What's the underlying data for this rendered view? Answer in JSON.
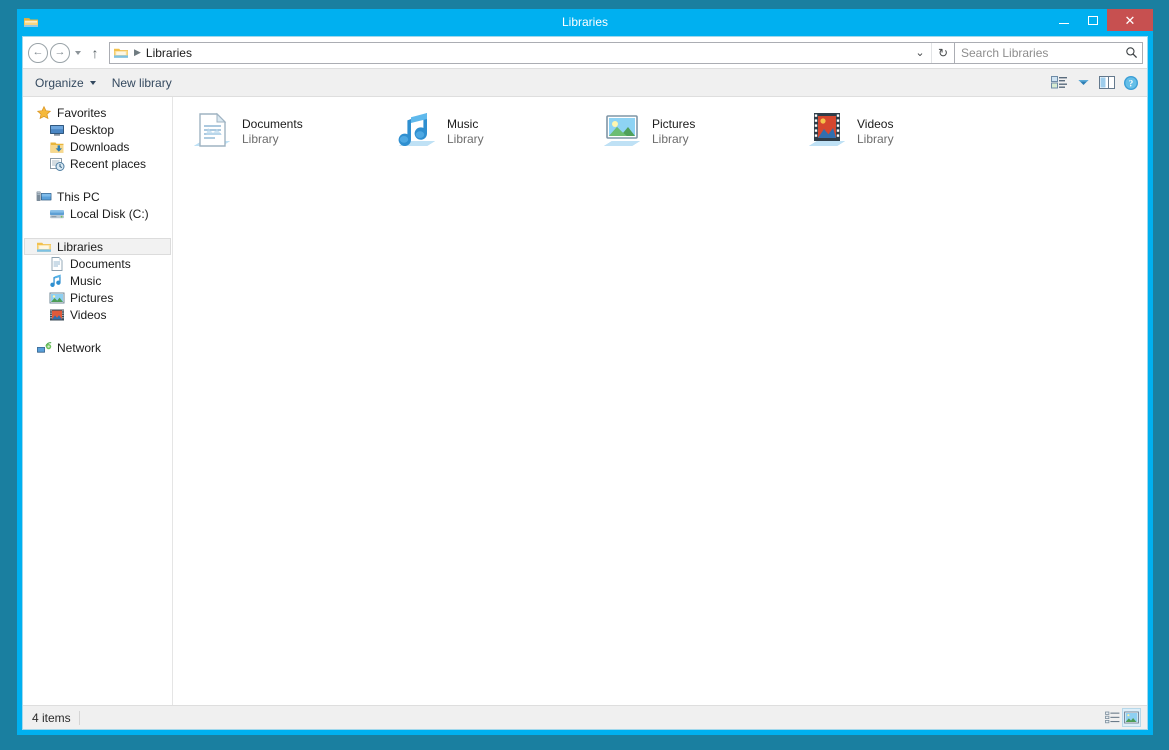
{
  "window": {
    "title": "Libraries",
    "title_icon": "folder-library-icon",
    "minimize_label": "Minimize",
    "maximize_label": "Maximize",
    "close_label": "Close",
    "close_glyph": "✕",
    "accent_color": "#00b0f0",
    "close_color": "#c75050",
    "desktop_color": "#1a7fa0"
  },
  "addressbar": {
    "back_glyph": "←",
    "forward_glyph": "→",
    "up_glyph": "↑",
    "back_label": "Back",
    "forward_label": "Forward",
    "recent_label": "Recent locations",
    "up_label": "Up to Desktop",
    "crumb_icon": "libraries-icon",
    "crumb_sep": "▶",
    "crumb_label": "Libraries",
    "history_dropdown_glyph": "⌄",
    "refresh_glyph": "↻",
    "refresh_label": "Refresh"
  },
  "search": {
    "placeholder": "Search Libraries",
    "value": "",
    "icon": "search-icon"
  },
  "commandbar": {
    "organize_label": "Organize",
    "new_library_label": "New library",
    "change_view_label": "Change your view",
    "preview_pane_label": "Show the preview pane",
    "help_label": "Help"
  },
  "navpane": {
    "groups": [
      {
        "name": "favorites",
        "items": [
          {
            "label": "Favorites",
            "icon": "star-icon",
            "level": 0,
            "selected": false
          },
          {
            "label": "Desktop",
            "icon": "desktop-icon",
            "level": 1,
            "selected": false
          },
          {
            "label": "Downloads",
            "icon": "downloads-icon",
            "level": 1,
            "selected": false
          },
          {
            "label": "Recent places",
            "icon": "recent-places-icon",
            "level": 1,
            "selected": false
          }
        ]
      },
      {
        "name": "this-pc",
        "items": [
          {
            "label": "This PC",
            "icon": "computer-icon",
            "level": 0,
            "selected": false
          },
          {
            "label": "Local Disk (C:)",
            "icon": "hard-drive-icon",
            "level": 1,
            "selected": false
          }
        ]
      },
      {
        "name": "libraries",
        "items": [
          {
            "label": "Libraries",
            "icon": "libraries-icon",
            "level": 0,
            "selected": true
          },
          {
            "label": "Documents",
            "icon": "documents-library-icon",
            "level": 1,
            "selected": false
          },
          {
            "label": "Music",
            "icon": "music-library-icon",
            "level": 1,
            "selected": false
          },
          {
            "label": "Pictures",
            "icon": "pictures-library-icon",
            "level": 1,
            "selected": false
          },
          {
            "label": "Videos",
            "icon": "videos-library-icon",
            "level": 1,
            "selected": false
          }
        ]
      },
      {
        "name": "network",
        "items": [
          {
            "label": "Network",
            "icon": "network-icon",
            "level": 0,
            "selected": false
          }
        ]
      }
    ]
  },
  "content": {
    "items": [
      {
        "name": "Documents",
        "subtitle": "Library",
        "icon": "documents-library-icon"
      },
      {
        "name": "Music",
        "subtitle": "Library",
        "icon": "music-library-icon"
      },
      {
        "name": "Pictures",
        "subtitle": "Library",
        "icon": "pictures-library-icon"
      },
      {
        "name": "Videos",
        "subtitle": "Library",
        "icon": "videos-library-icon"
      }
    ]
  },
  "statusbar": {
    "item_count": "4 items",
    "details_view_label": "Details view",
    "large_icons_view_label": "Large icons view"
  }
}
